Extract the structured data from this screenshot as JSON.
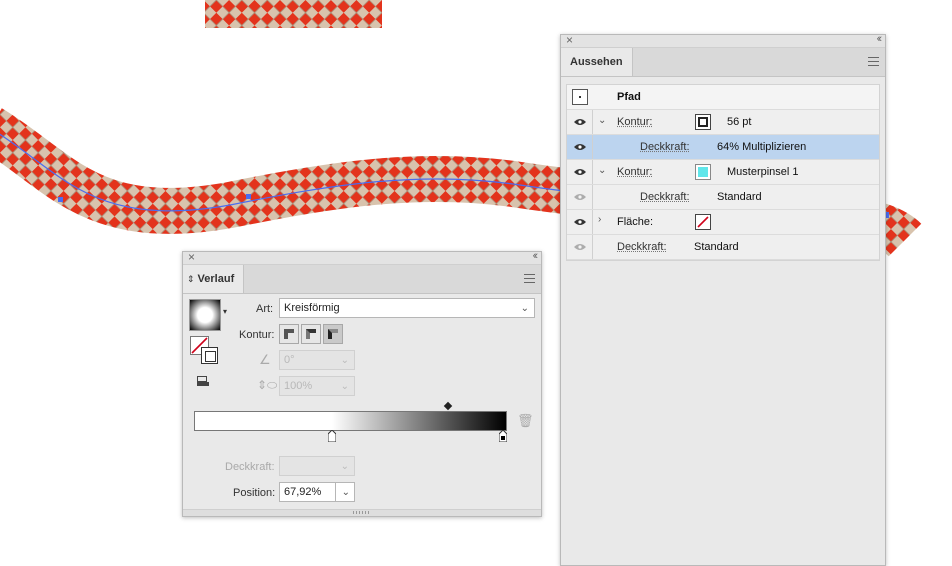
{
  "appearance_panel": {
    "tab_label": "Aussehen",
    "object_label": "Pfad",
    "rows": [
      {
        "type": "kontur",
        "label": "Kontur:",
        "value": "56 pt",
        "expanded": true
      },
      {
        "type": "opacity",
        "label": "Deckkraft:",
        "value": "64% Multiplizieren",
        "selected": true
      },
      {
        "type": "kontur",
        "label": "Kontur:",
        "value": "Musterpinsel 1",
        "expanded": true
      },
      {
        "type": "opacity",
        "label": "Deckkraft:",
        "value": "Standard"
      },
      {
        "type": "fill",
        "label": "Fläche:",
        "value": ""
      },
      {
        "type": "opacity",
        "label": "Deckkraft:",
        "value": "Standard"
      }
    ],
    "swatch_colors": {
      "stroke2": "#5fe6ea",
      "fill_none_slash": "#d0021b"
    }
  },
  "gradient_panel": {
    "tab_label": "Verlauf",
    "type_label": "Art:",
    "type_value": "Kreisförmig",
    "stroke_label": "Kontur:",
    "angle_value": "0°",
    "aspect_value": "100%",
    "opacity_label": "Deckkraft:",
    "position_label": "Position:",
    "position_value": "67,92%"
  },
  "colors": {
    "rope_red": "#e3331c",
    "rope_beige": "#d8c3ad",
    "path_blue": "#4a6cf0"
  }
}
